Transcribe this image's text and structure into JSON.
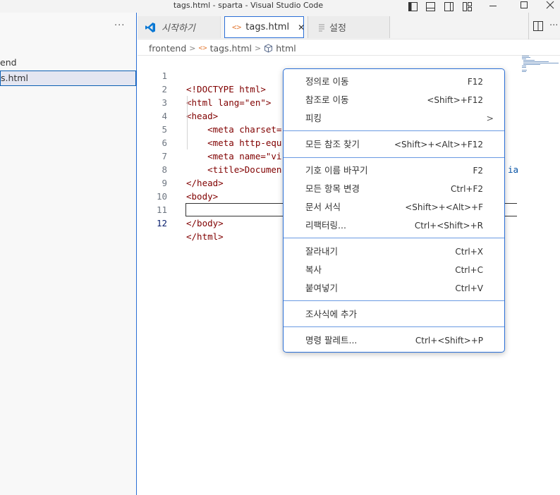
{
  "window": {
    "title": "tags.html - sparta - Visual Studio Code",
    "minimize_glyph": "─",
    "maximize_glyph": "☐",
    "close_glyph": "✕"
  },
  "sidebar": {
    "more_actions": "···",
    "folder_label": "end",
    "file_label": "s.html"
  },
  "tabs": [
    {
      "label": "시작하기",
      "icon": "vscode-logo-icon"
    },
    {
      "label": "tags.html",
      "icon": "html-code-icon",
      "close": "✕"
    },
    {
      "label": "설정",
      "icon": "settings-file-icon"
    }
  ],
  "editor_actions": {
    "more": "···"
  },
  "breadcrumb": {
    "folder": "frontend",
    "file": "tags.html",
    "symbol": "html",
    "separator": ">"
  },
  "code": {
    "line_numbers": [
      "1",
      "2",
      "3",
      "4",
      "5",
      "6",
      "7",
      "8",
      "9",
      "10",
      "11",
      "12"
    ],
    "lines": [
      "<!DOCTYPE html>",
      "<html lang=\"en\">",
      "<head>",
      "    <meta charset=",
      "    <meta http-equ",
      "    <meta name=\"vi",
      "    <title>Documen",
      "</head>",
      "<body>",
      "",
      "</body>",
      "</html>"
    ],
    "overflow_text": "ia"
  },
  "context_menu": {
    "groups": [
      [
        {
          "label": "정의로 이동",
          "key": "F12"
        },
        {
          "label": "참조로 이동",
          "key": "<Shift>+F12"
        },
        {
          "label": "피킹",
          "submenu": ">"
        }
      ],
      [
        {
          "label": "모든 참조 찾기",
          "key": "<Shift>+<Alt>+F12"
        }
      ],
      [
        {
          "label": "기호 이름 바꾸기",
          "key": "F2"
        },
        {
          "label": "모든 항목 변경",
          "key": "Ctrl+F2"
        },
        {
          "label": "문서 서식",
          "key": "<Shift>+<Alt>+F"
        },
        {
          "label": "리팩터링...",
          "key": "Ctrl+<Shift>+R"
        }
      ],
      [
        {
          "label": "잘라내기",
          "key": "Ctrl+X"
        },
        {
          "label": "복사",
          "key": "Ctrl+C"
        },
        {
          "label": "붙여넣기",
          "key": "Ctrl+V"
        }
      ],
      [
        {
          "label": "조사식에 추가"
        }
      ],
      [
        {
          "label": "명령 팔레트...",
          "key": "Ctrl+<Shift>+P"
        }
      ]
    ]
  },
  "colors": {
    "accent": "#2b6fd6",
    "keyword": "#0000ff",
    "tag": "#800000",
    "attribute": "#e50000",
    "string": "#0451a5"
  }
}
